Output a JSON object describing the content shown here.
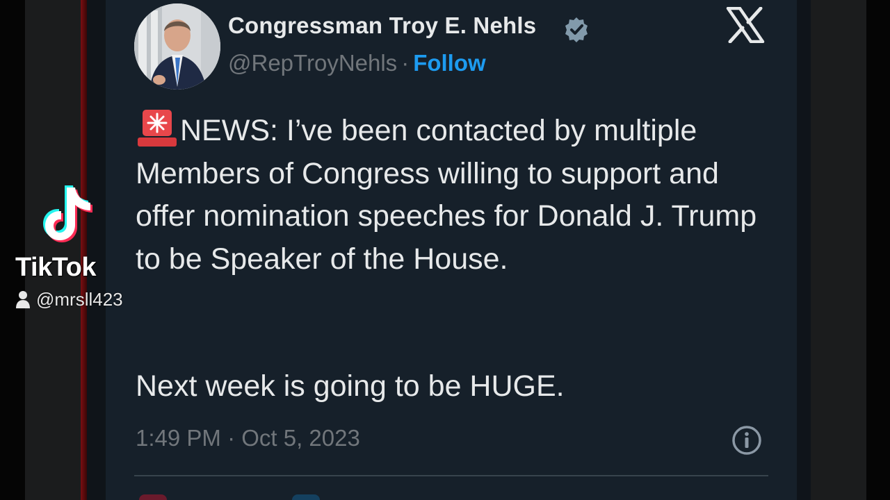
{
  "tweet": {
    "author_name": "Congressman Troy E. Nehls",
    "handle": "@RepTroyNehls",
    "separator": "·",
    "follow_label": "Follow",
    "body_paragraph_1": "NEWS: I’ve been contacted by multiple Members of Congress willing to support and offer nomination speeches for Donald J. Trump to be Speaker of the House.",
    "body_paragraph_2": "Next week is going to be HUGE.",
    "timestamp": "1:49 PM · Oct 5, 2023",
    "icons": {
      "verified": "verified-badge-icon",
      "platform": "x-logo-icon",
      "info": "info-icon",
      "emoji": "rotating-light-emoji"
    }
  },
  "overlay": {
    "app_name": "TikTok",
    "username": "@mrsll423"
  },
  "colors": {
    "card_background": "#16202a",
    "text_primary": "#e7e9ea",
    "text_secondary": "#71767b",
    "accent": "#1d9bf0"
  }
}
